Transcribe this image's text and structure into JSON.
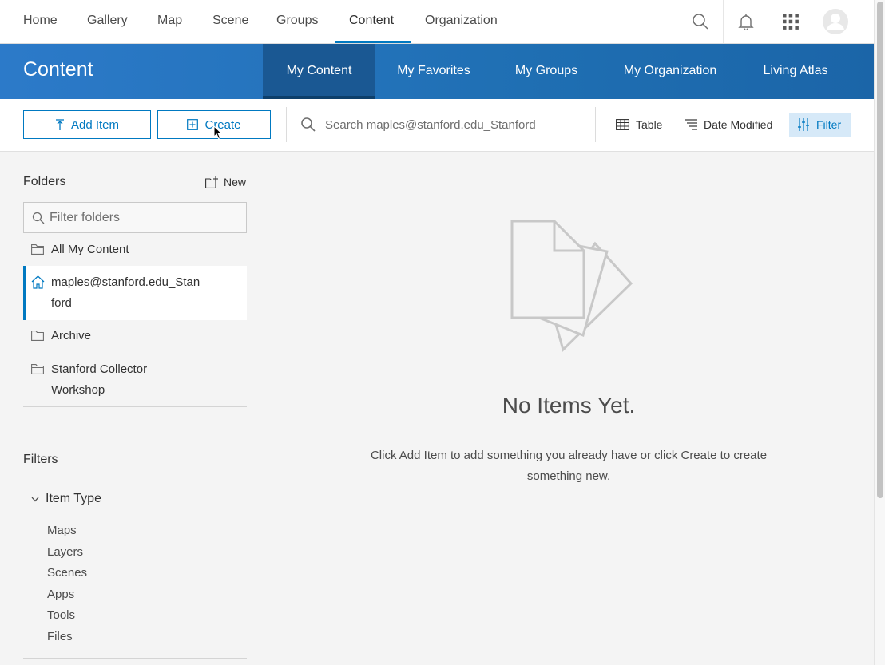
{
  "topnav": {
    "links": [
      "Home",
      "Gallery",
      "Map",
      "Scene",
      "Groups",
      "Content",
      "Organization"
    ],
    "active": "Content",
    "icons": [
      "search-icon",
      "bell-icon",
      "app-launcher-icon",
      "user-avatar"
    ]
  },
  "header": {
    "title": "Content",
    "tabs": [
      "My Content",
      "My Favorites",
      "My Groups",
      "My Organization",
      "Living Atlas"
    ],
    "active_tab": "My Content"
  },
  "toolbar": {
    "add_item_label": "Add Item",
    "create_label": "Create",
    "search_placeholder": "Search maples@stanford.edu_Stanford",
    "table_label": "Table",
    "sort_label": "Date Modified",
    "filter_label": "Filter"
  },
  "sidebar": {
    "folders_title": "Folders",
    "new_label": "New",
    "filter_placeholder": "Filter folders",
    "folders": [
      {
        "line1": "All My Content",
        "line2": ""
      },
      {
        "line1": "maples@stanford.edu_Stan",
        "line2": "ford"
      },
      {
        "line1": "Archive",
        "line2": ""
      },
      {
        "line1": "Stanford Collector",
        "line2": "Workshop"
      }
    ],
    "selected_folder": 1,
    "filters_title": "Filters",
    "item_type_title": "Item Type",
    "item_types": [
      "Maps",
      "Layers",
      "Scenes",
      "Apps",
      "Tools",
      "Files"
    ]
  },
  "main": {
    "empty_title": "No Items Yet.",
    "empty_description": "Click Add Item to add something you already have or click Create to create something new."
  },
  "colors": {
    "accent": "#0079c1",
    "header_blue": "#1f6fb3",
    "active_tab": "#1a5893",
    "page_bg": "#f4f4f4"
  }
}
